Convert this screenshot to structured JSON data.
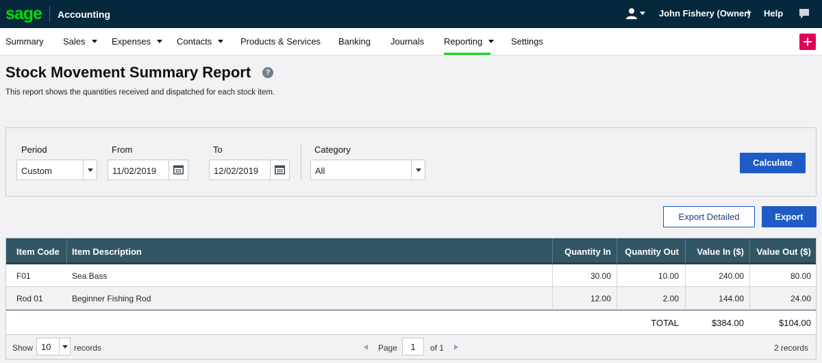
{
  "topbar": {
    "logo": "sage",
    "app_name": "Accounting",
    "user_name": "John Fishery (Owner)",
    "help": "Help"
  },
  "nav": {
    "items": [
      {
        "label": "Summary"
      },
      {
        "label": "Sales"
      },
      {
        "label": "Expenses"
      },
      {
        "label": "Contacts"
      },
      {
        "label": "Products & Services"
      },
      {
        "label": "Banking"
      },
      {
        "label": "Journals"
      },
      {
        "label": "Reporting"
      },
      {
        "label": "Settings"
      }
    ],
    "active": "Reporting"
  },
  "page": {
    "title": "Stock Movement Summary Report",
    "help_glyph": "?",
    "description": "This report shows the quantities received and dispatched for each stock item."
  },
  "filters": {
    "period_label": "Period",
    "period_value": "Custom",
    "from_label": "From",
    "from_value": "11/02/2019",
    "to_label": "To",
    "to_value": "12/02/2019",
    "category_label": "Category",
    "category_value": "All",
    "calculate_label": "Calculate"
  },
  "actions": {
    "export_detailed_label": "Export Detailed",
    "export_label": "Export"
  },
  "table": {
    "headers": {
      "item_code": "Item Code",
      "item_description": "Item Description",
      "quantity_in": "Quantity In",
      "quantity_out": "Quantity Out",
      "value_in": "Value In ($)",
      "value_out": "Value Out ($)"
    },
    "rows": [
      {
        "item_code": "F01",
        "item_description": "Sea Bass",
        "quantity_in": "30.00",
        "quantity_out": "10.00",
        "value_in": "240.00",
        "value_out": "80.00"
      },
      {
        "item_code": "Rod 01",
        "item_description": "Beginner Fishing Rod",
        "quantity_in": "12.00",
        "quantity_out": "2.00",
        "value_in": "144.00",
        "value_out": "24.00"
      }
    ],
    "total": {
      "label": "TOTAL",
      "value_in": "$384.00",
      "value_out": "$104.00"
    }
  },
  "footer": {
    "show_label": "Show",
    "records_per_page": "10",
    "records_label": "records",
    "page_label": "Page",
    "page_value": "1",
    "of_label": "of 1",
    "record_count": "2 records"
  },
  "colors": {
    "topbar": "#06283d",
    "brand_green": "#00dc06",
    "primary_button": "#1f5bc6",
    "table_header": "#335667",
    "plus_button": "#e0005a"
  }
}
